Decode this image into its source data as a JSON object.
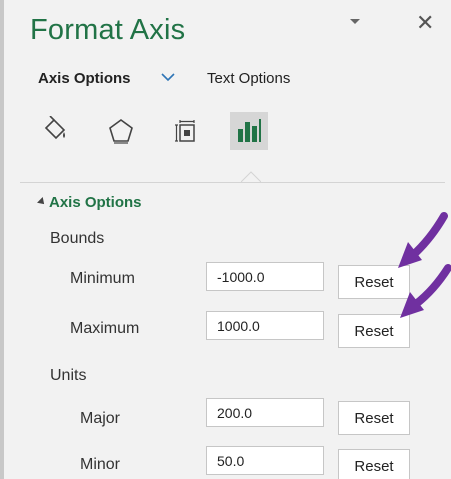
{
  "pane": {
    "title": "Format Axis",
    "menu_icon": "chevron-down-icon",
    "close_label": "✕"
  },
  "tabs": {
    "axis_options": "Axis Options",
    "text_options": "Text Options"
  },
  "icons": [
    "fill-line-icon",
    "effects-icon",
    "size-properties-icon",
    "axis-options-icon"
  ],
  "section": {
    "title": "Axis Options",
    "bounds_label": "Bounds",
    "units_label": "Units"
  },
  "bounds": {
    "minimum": {
      "label": "Minimum",
      "value": "-1000.0",
      "reset": "Reset"
    },
    "maximum": {
      "label": "Maximum",
      "value": "1000.0",
      "reset": "Reset"
    }
  },
  "units": {
    "major": {
      "label": "Major",
      "value": "200.0",
      "reset": "Reset"
    },
    "minor": {
      "label": "Minor",
      "value": "50.0",
      "reset": "Reset"
    }
  },
  "colors": {
    "accent": "#217346",
    "annotation_arrow": "#7030a0"
  }
}
